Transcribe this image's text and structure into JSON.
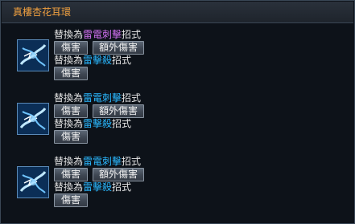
{
  "window": {
    "title": "真樓杏花耳環"
  },
  "skills": [
    {
      "icon": "lightning-skill-icon",
      "replace_line": {
        "prefix": "替換為",
        "skill": "雷電刺擊",
        "skill_color": "#d070f0",
        "suffix": "招式"
      },
      "buttons_row1": [
        "傷害",
        "額外傷害"
      ],
      "replace_line2": {
        "prefix": "替換為",
        "skill": "雷擊殺",
        "skill_color": "#2ab8ff",
        "suffix": "招式"
      },
      "buttons_row2": [
        "傷害"
      ]
    },
    {
      "icon": "lightning-skill-icon",
      "replace_line": {
        "prefix": "替換為",
        "skill": "雷電刺擊",
        "skill_color": "#2ab8ff",
        "suffix": "招式"
      },
      "buttons_row1": [
        "傷害",
        "額外傷害"
      ],
      "replace_line2": {
        "prefix": "替換為",
        "skill": "雷擊殺",
        "skill_color": "#2ab8ff",
        "suffix": "招式"
      },
      "buttons_row2": [
        "傷害"
      ]
    },
    {
      "icon": "lightning-skill-icon",
      "replace_line": {
        "prefix": "替換為",
        "skill": "雷電刺擊",
        "skill_color": "#2ab8ff",
        "suffix": "招式"
      },
      "buttons_row1": [
        "傷害",
        "額外傷害"
      ],
      "replace_line2": {
        "prefix": "替換為",
        "skill": "雷擊殺",
        "skill_color": "#2ab8ff",
        "suffix": "招式"
      },
      "buttons_row2": [
        "傷害"
      ]
    }
  ],
  "colors": {
    "title": "#f0a040",
    "text": "#e6e6e6",
    "panel_bg": "#0d1219",
    "button_border": "#8893a0"
  }
}
